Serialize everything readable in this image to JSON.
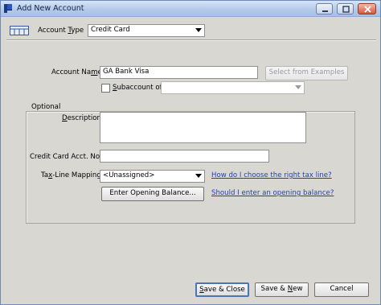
{
  "window": {
    "title": "Add New Account"
  },
  "account_type": {
    "label_pre": "Account ",
    "label_u": "T",
    "label_post": "ype",
    "value": "Credit Card"
  },
  "account_name": {
    "label_pre": "Account Na",
    "label_u": "m",
    "label_post": "e",
    "value": "GA Bank Visa"
  },
  "select_examples_label": "Select from Examples",
  "subaccount": {
    "label_u": "S",
    "label_post": "ubaccount of",
    "value": ""
  },
  "optional_label": "Optional",
  "description": {
    "label_u": "D",
    "label_post": "escription",
    "value": ""
  },
  "cc_acct_no": {
    "label": "Credit Card Acct. No.",
    "value": ""
  },
  "tax_line": {
    "label_pre": "Ta",
    "label_u": "x",
    "label_post": "-Line Mapping",
    "value": "<Unassigned>"
  },
  "enter_opening_balance_label": "Enter Opening Balance...",
  "tax_help_link": "How do I choose the right tax line?",
  "opening_balance_help_link": "Should I enter an opening balance?",
  "footer": {
    "save_close_u": "S",
    "save_close_post": "ave & Close",
    "save_new_pre": "Save & ",
    "save_new_u": "N",
    "save_new_post": "ew",
    "cancel": "Cancel"
  },
  "icons": [
    "app-icon",
    "account-register-icon",
    "minimize-icon",
    "maximize-icon",
    "close-icon",
    "dropdown-arrow-icon"
  ]
}
